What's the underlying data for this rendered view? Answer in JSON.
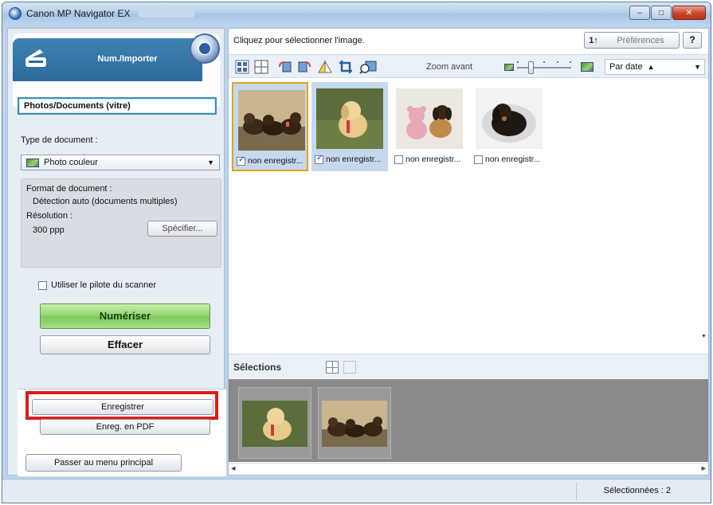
{
  "window": {
    "title": "Canon MP Navigator EX",
    "min_label": "–",
    "max_label": "□",
    "close_label": "✕"
  },
  "left": {
    "scan_label": "Num./Importer",
    "source_button": "Photos/Documents (vitre)",
    "doc_type_label": "Type de document :",
    "doc_type_value": "Photo couleur",
    "format_label": "Format de document :",
    "format_value": "Détection auto (documents multiples)",
    "resolution_label": "Résolution :",
    "resolution_value": "300 ppp",
    "specify_button": "Spécifier...",
    "scanner_driver_label": "Utiliser le pilote du scanner",
    "scanner_driver_checked": false,
    "scan_button": "Numériser",
    "clear_button": "Effacer",
    "save_button": "Enregistrer",
    "save_pdf_button": "Enreg. en PDF",
    "main_menu_button": "Passer au menu principal"
  },
  "right": {
    "instruction": "Cliquez pour sélectionner l'image.",
    "preferences_icon": "1↑",
    "preferences_button": "Préférences",
    "help_button": "?",
    "zoom_label": "Zoom avant",
    "sort_value": "Par date",
    "sort_direction": "▲",
    "thumbnails": [
      {
        "caption": "non enregistr...",
        "checked": true,
        "selected": true,
        "focused": true
      },
      {
        "caption": "non enregistr...",
        "checked": true,
        "selected": true,
        "focused": false
      },
      {
        "caption": "non enregistr...",
        "checked": false,
        "selected": false,
        "focused": false
      },
      {
        "caption": "non enregistr...",
        "checked": false,
        "selected": false,
        "focused": false
      }
    ],
    "selections_label": "Sélections"
  },
  "status": {
    "selected_text": "Sélectionnées : 2"
  },
  "colors": {
    "accent_blue": "#2c6a9b",
    "scan_green": "#8ed26b",
    "highlight_red": "#e01a1a",
    "selection_blue": "#c5d8ee",
    "focus_orange": "#e6a31f"
  }
}
